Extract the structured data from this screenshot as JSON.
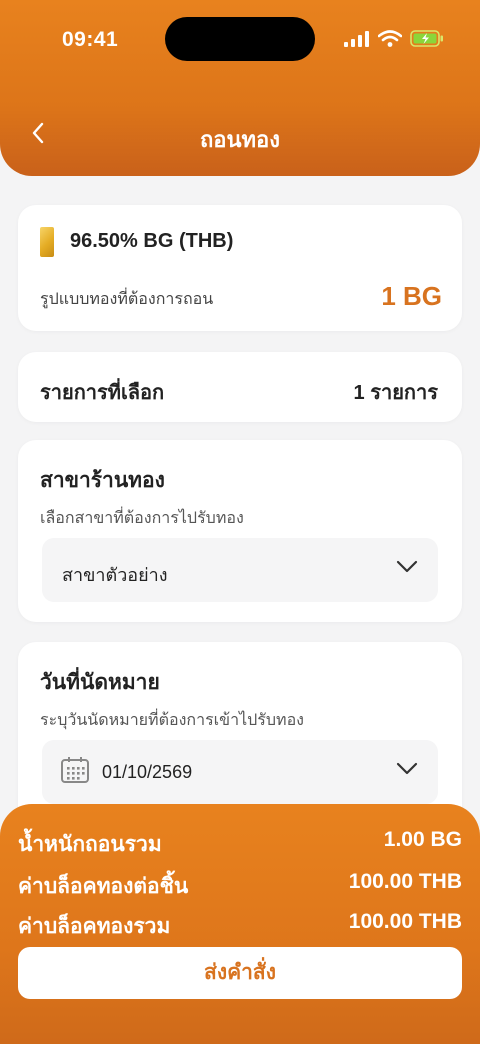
{
  "status": {
    "time": "09:41"
  },
  "header": {
    "title": "ถอนทอง"
  },
  "product": {
    "name": "96.50% BG (THB)",
    "form_label": "รูปแบบทองที่ต้องการถอน",
    "form_value": "1 BG"
  },
  "selected": {
    "label": "รายการที่เลือก",
    "value": "1 รายการ"
  },
  "branch": {
    "title": "สาขาร้านทอง",
    "subtitle": "เลือกสาขาที่ต้องการไปรับทอง",
    "value": "สาขาตัวอย่าง"
  },
  "appointment": {
    "title": "วันที่นัดหมาย",
    "subtitle": "ระบุวันนัดหมายที่ต้องการเข้าไปรับทอง",
    "value": "01/10/2569"
  },
  "summary": [
    {
      "label": "น้ำหนักถอนรวม",
      "value": "1.00 BG"
    },
    {
      "label": "ค่าบล็อคทองต่อชิ้น",
      "value": "100.00 THB"
    },
    {
      "label": "ค่าบล็อคทองรวม",
      "value": "100.00 THB"
    }
  ],
  "submit_label": "ส่งคำสั่ง",
  "colors": {
    "accent": "#e07a1c",
    "highlight": "#d8731f"
  }
}
